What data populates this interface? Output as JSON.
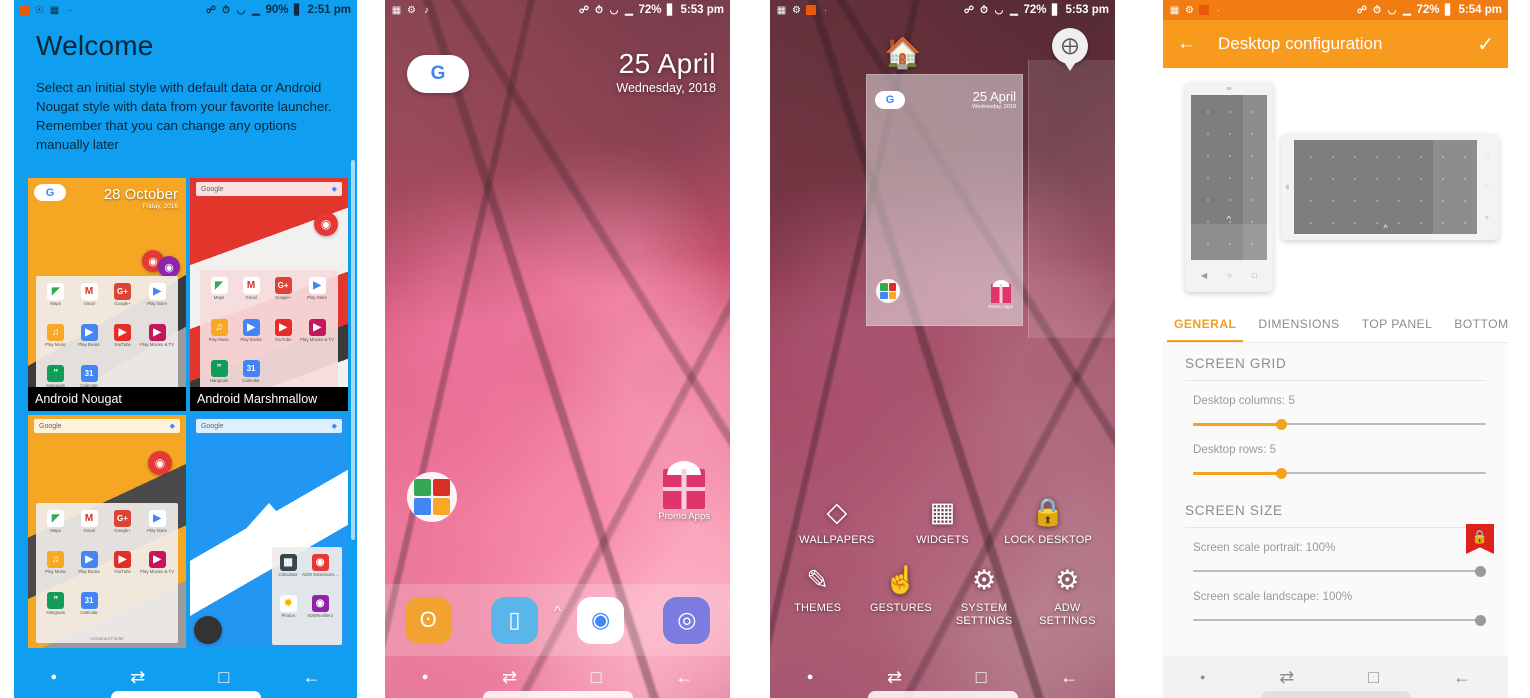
{
  "panels": [
    {
      "id": "welcome",
      "name": "ADW Launcher welcome / style chooser",
      "statusbar": {
        "left_icons": [
          "orange-square-icon",
          "whatsapp-icon",
          "gallery-icon",
          "more-dots-icon"
        ],
        "right_icons": [
          "bluetooth-icon",
          "alarm-icon",
          "wifi-icon",
          "signal-icon"
        ],
        "battery": "90%",
        "time": "2:51 pm"
      },
      "title": "Welcome",
      "body": "Select an initial style with default data or Android Nougat style with data from your favorite launcher.\nRemember that you can change any options manually later",
      "cards": [
        {
          "label": "Android Nougat",
          "date": "28 October",
          "subdate": "Friday, 2016"
        },
        {
          "label": "Android Marshmallow",
          "date": "",
          "subdate": ""
        },
        {
          "label": "",
          "date": "",
          "subdate": ""
        },
        {
          "label": "",
          "date": "",
          "subdate": ""
        }
      ],
      "folder_apps": [
        {
          "name": "Maps",
          "glyph": "◤",
          "color": "#ffffff"
        },
        {
          "name": "Gmail",
          "glyph": "M",
          "color": "#ffffff"
        },
        {
          "name": "Google+",
          "glyph": "G+",
          "color": "#db4437"
        },
        {
          "name": "Play Store",
          "glyph": "▶",
          "color": "#ffffff"
        },
        {
          "name": "Play Music",
          "glyph": "♫",
          "color": "#f9a825"
        },
        {
          "name": "Play Books",
          "glyph": "▶",
          "color": "#4285f4"
        },
        {
          "name": "YouTube",
          "glyph": "▶",
          "color": "#e52d27"
        },
        {
          "name": "Play Movies & TV",
          "glyph": "▶",
          "color": "#c2185b"
        },
        {
          "name": "Hangouts",
          "glyph": "”",
          "color": "#0f9d58"
        },
        {
          "name": "Calendar",
          "glyph": "31",
          "color": "#4285f4"
        }
      ],
      "folder_footer": "Unnamed Folder",
      "search_hint": "Google",
      "adw_apps": [
        {
          "name": "Calculator",
          "glyph": "▦",
          "color": "#37474f"
        },
        {
          "name": "ADW Extensions...",
          "glyph": "◉",
          "color": "#e53935"
        },
        {
          "name": "Photos",
          "glyph": "✸",
          "color": "#ffffff"
        },
        {
          "name": "ADWNotifier2",
          "glyph": "◉",
          "color": "#8e24aa"
        }
      ],
      "navbar": [
        "recents-dot-icon",
        "multiwindow-icon",
        "home-square-icon",
        "back-arrow-icon"
      ]
    },
    {
      "id": "homescreen",
      "name": "ADW home screen",
      "statusbar": {
        "left_icons": [
          "gallery-icon",
          "settings-icon",
          "music-icon"
        ],
        "right_icons": [
          "bluetooth-icon",
          "alarm-icon",
          "wifi-icon",
          "signal-icon"
        ],
        "battery": "72%",
        "time": "5:53 pm"
      },
      "search_pill": "G",
      "date": "25 April",
      "weekday": "Wednesday, 2018",
      "folder_label": "",
      "promo_label": "Promo Apps",
      "drawer_hint": "chevron-up-icon",
      "dock": [
        {
          "name": "contacts",
          "glyph": "ʘ",
          "color": "#f2a22e"
        },
        {
          "name": "messages",
          "glyph": "▭",
          "color": "#5ab5e8"
        },
        {
          "name": "chrome",
          "glyph": "◉",
          "color": "#ffffff"
        },
        {
          "name": "camera",
          "glyph": "◎",
          "color": "#7b7ce0"
        }
      ],
      "navbar": [
        "recents-dot-icon",
        "multiwindow-icon",
        "home-square-icon",
        "back-arrow-icon"
      ]
    },
    {
      "id": "overview",
      "name": "Home screen overview / quick actions",
      "statusbar": {
        "left_icons": [
          "gallery-icon",
          "settings-icon",
          "music-icon",
          "dot-icon"
        ],
        "right_icons": [
          "bluetooth-icon",
          "alarm-icon",
          "wifi-icon",
          "signal-icon"
        ],
        "battery": "72%",
        "time": "5:53 pm"
      },
      "set_home_label": "",
      "add_page_label": "",
      "page_preview": {
        "date": "25 April",
        "weekday": "Wednesday, 2018",
        "search_pill": "G",
        "promo_label": "Promo Apps"
      },
      "quick_actions_row1": [
        {
          "label": "WALLPAPERS",
          "icon": "wallpapers-icon"
        },
        {
          "label": "WIDGETS",
          "icon": "widgets-icon"
        },
        {
          "label": "LOCK DESKTOP",
          "icon": "lock-icon"
        }
      ],
      "quick_actions_row2": [
        {
          "label": "THEMES",
          "icon": "themes-icon"
        },
        {
          "label": "GESTURES",
          "icon": "gestures-icon"
        },
        {
          "label": "SYSTEM\nSETTINGS",
          "icon": "system-settings-icon"
        },
        {
          "label": "ADW SETTINGS",
          "icon": "adw-settings-icon"
        }
      ],
      "navbar": [
        "recents-dot-icon",
        "multiwindow-icon",
        "home-square-icon",
        "back-arrow-icon"
      ]
    },
    {
      "id": "desktop-configuration",
      "name": "Desktop configuration settings",
      "statusbar": {
        "left_icons": [
          "gallery-icon",
          "settings-icon",
          "orange-square-icon",
          "dot-icon"
        ],
        "right_icons": [
          "bluetooth-icon",
          "alarm-icon",
          "wifi-icon",
          "signal-icon"
        ],
        "battery": "72%",
        "time": "5:54 pm"
      },
      "appbar": {
        "back": "back-arrow-icon",
        "title": "Desktop configuration",
        "confirm": "check-icon"
      },
      "tabs": [
        {
          "label": "GENERAL",
          "active": true
        },
        {
          "label": "DIMENSIONS",
          "active": false
        },
        {
          "label": "TOP PANEL",
          "active": false
        },
        {
          "label": "BOTTOM PA",
          "active": false
        }
      ],
      "sections": [
        {
          "heading": "SCREEN GRID",
          "locked": false,
          "controls": [
            {
              "label": "Desktop columns: 5",
              "value": 5,
              "percent": 30,
              "style": "orange"
            },
            {
              "label": "Desktop rows: 5",
              "value": 5,
              "percent": 30,
              "style": "orange"
            }
          ]
        },
        {
          "heading": "SCREEN SIZE",
          "locked": true,
          "lock_badge": "lock-icon",
          "controls": [
            {
              "label": "Screen scale portrait: 100%",
              "value": 100,
              "percent": 100,
              "style": "grey"
            },
            {
              "label": "Screen scale landscape: 100%",
              "value": 100,
              "percent": 100,
              "style": "grey"
            }
          ]
        }
      ],
      "navbar": [
        "recents-dot-icon",
        "multiwindow-icon",
        "home-square-icon",
        "back-arrow-icon"
      ]
    }
  ],
  "colors": {
    "welcome_blue": "#109ff0",
    "accent_orange": "#f79a1e",
    "statusbar_orange": "#f07c12",
    "lock_red": "#e0201b",
    "slider_grey": "#9a9a9a"
  }
}
